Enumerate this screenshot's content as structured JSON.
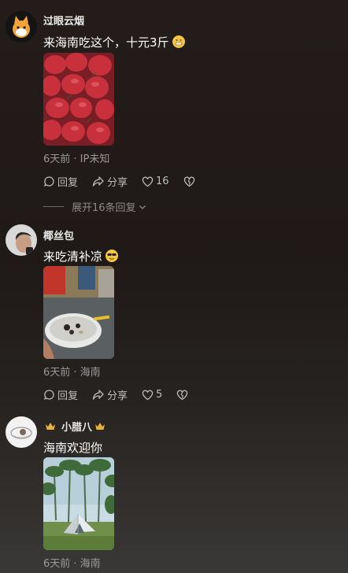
{
  "comments": [
    {
      "username": "过眼云烟",
      "text": "来海南吃这个，十元3斤",
      "emoji": "grinning-face-icon",
      "meta": "6天前 · IP未知",
      "reply_label": "回复",
      "share_label": "分享",
      "like_count": "16",
      "expand_label": "展开16条回复"
    },
    {
      "username": "椰丝包",
      "text": "来吃清补凉",
      "emoji": "sunglasses-face-icon",
      "meta": "6天前 · 海南",
      "reply_label": "回复",
      "share_label": "分享",
      "like_count": "5"
    },
    {
      "username": "小腊八",
      "text": "海南欢迎你",
      "meta": "6天前 · 海南"
    }
  ],
  "colors": {
    "background": "#211b19",
    "meta_text": "#9a9a9a",
    "crown": "#e9b13a"
  }
}
